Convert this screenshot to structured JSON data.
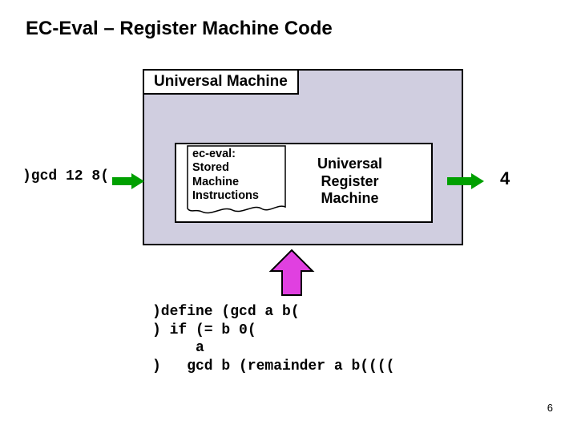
{
  "slide": {
    "title": "EC-Eval – Register Machine Code",
    "page_number": "6"
  },
  "outer_box": {
    "title": "Universal Machine"
  },
  "input_expr": ")gcd 12 8(",
  "note": {
    "l1": "ec-eval:",
    "l2": "Stored",
    "l3": "Machine",
    "l4": "Instructions"
  },
  "urm": {
    "l1": "Universal",
    "l2": "Register",
    "l3": "Machine"
  },
  "output_value": "4",
  "code": {
    "line1": ")define (gcd a b(",
    "line2": ") if (= b 0(",
    "line3": "     a",
    "line4": ")   gcd b (remainder a b(((("
  }
}
